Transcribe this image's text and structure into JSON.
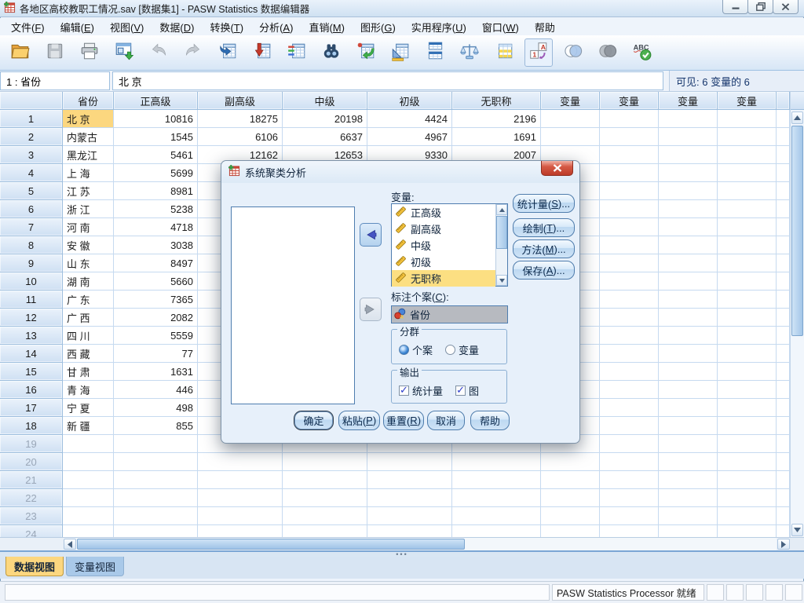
{
  "window": {
    "title": "各地区高校教职工情况.sav [数据集1] - PASW Statistics 数据编辑器"
  },
  "menu": {
    "items": [
      "文件(F)",
      "编辑(E)",
      "视图(V)",
      "数据(D)",
      "转换(T)",
      "分析(A)",
      "直销(M)",
      "图形(G)",
      "实用程序(U)",
      "窗口(W)",
      "帮助"
    ]
  },
  "toolbar": {
    "buttons": [
      {
        "name": "open-file",
        "enabled": true
      },
      {
        "name": "save",
        "enabled": false
      },
      {
        "name": "print",
        "enabled": true
      },
      {
        "name": "recall-dialogs",
        "enabled": true
      },
      {
        "name": "undo",
        "enabled": false
      },
      {
        "name": "redo",
        "enabled": false
      },
      {
        "name": "goto-case",
        "enabled": true
      },
      {
        "name": "goto-variable",
        "enabled": true
      },
      {
        "name": "variables",
        "enabled": true
      },
      {
        "name": "find",
        "enabled": true
      },
      {
        "name": "insert-cases",
        "enabled": true
      },
      {
        "name": "insert-variable",
        "enabled": true
      },
      {
        "name": "split-file",
        "enabled": true
      },
      {
        "name": "weight-cases",
        "enabled": true
      },
      {
        "name": "select-cases",
        "enabled": true
      },
      {
        "name": "value-labels",
        "enabled": true,
        "pressed": true
      },
      {
        "name": "use-variable-sets",
        "enabled": true
      },
      {
        "name": "show-all-variables",
        "enabled": true
      },
      {
        "name": "spell-check",
        "enabled": true
      }
    ]
  },
  "cellref": {
    "position": "1 : 省份",
    "value": "北 京",
    "visible_info": "可见: 6 变量的 6"
  },
  "grid": {
    "columns": [
      "省份",
      "正高级",
      "副高级",
      "中级",
      "初级",
      "无职称",
      "变量",
      "变量",
      "变量",
      "变量",
      ""
    ],
    "rows": [
      {
        "n": "1",
        "empty": false,
        "cells": [
          "北 京",
          "10816",
          "18275",
          "20198",
          "4424",
          "2196"
        ]
      },
      {
        "n": "2",
        "empty": false,
        "cells": [
          "内蒙古",
          "1545",
          "6106",
          "6637",
          "4967",
          "1691"
        ]
      },
      {
        "n": "3",
        "empty": false,
        "cells": [
          "黑龙江",
          "5461",
          "12162",
          "12653",
          "9330",
          "2007"
        ]
      },
      {
        "n": "4",
        "empty": false,
        "cells": [
          "上 海",
          "5699",
          "",
          "",
          "",
          ""
        ]
      },
      {
        "n": "5",
        "empty": false,
        "cells": [
          "江 苏",
          "8981",
          "",
          "",
          "",
          ""
        ]
      },
      {
        "n": "6",
        "empty": false,
        "cells": [
          "浙 江",
          "5238",
          "",
          "",
          "",
          ""
        ]
      },
      {
        "n": "7",
        "empty": false,
        "cells": [
          "河 南",
          "4718",
          "",
          "",
          "",
          ""
        ]
      },
      {
        "n": "8",
        "empty": false,
        "cells": [
          "安 徽",
          "3038",
          "",
          "",
          "",
          ""
        ]
      },
      {
        "n": "9",
        "empty": false,
        "cells": [
          "山 东",
          "8497",
          "",
          "",
          "",
          ""
        ]
      },
      {
        "n": "10",
        "empty": false,
        "cells": [
          "湖 南",
          "5660",
          "",
          "",
          "",
          ""
        ]
      },
      {
        "n": "11",
        "empty": false,
        "cells": [
          "广 东",
          "7365",
          "",
          "",
          "",
          ""
        ]
      },
      {
        "n": "12",
        "empty": false,
        "cells": [
          "广 西",
          "2082",
          "",
          "",
          "",
          ""
        ]
      },
      {
        "n": "13",
        "empty": false,
        "cells": [
          "四 川",
          "5559",
          "",
          "",
          "",
          ""
        ]
      },
      {
        "n": "14",
        "empty": false,
        "cells": [
          "西 藏",
          "77",
          "",
          "",
          "",
          ""
        ]
      },
      {
        "n": "15",
        "empty": false,
        "cells": [
          "甘 肃",
          "1631",
          "",
          "",
          "",
          ""
        ]
      },
      {
        "n": "16",
        "empty": false,
        "cells": [
          "青 海",
          "446",
          "",
          "",
          "",
          ""
        ]
      },
      {
        "n": "17",
        "empty": false,
        "cells": [
          "宁 夏",
          "498",
          "",
          "",
          "",
          ""
        ]
      },
      {
        "n": "18",
        "empty": false,
        "cells": [
          "新 疆",
          "855",
          "",
          "",
          "",
          ""
        ]
      },
      {
        "n": "19",
        "empty": true,
        "cells": [
          "",
          "",
          "",
          "",
          "",
          ""
        ]
      },
      {
        "n": "20",
        "empty": true,
        "cells": [
          "",
          "",
          "",
          "",
          "",
          ""
        ]
      },
      {
        "n": "21",
        "empty": true,
        "cells": [
          "",
          "",
          "",
          "",
          "",
          ""
        ]
      },
      {
        "n": "22",
        "empty": true,
        "cells": [
          "",
          "",
          "",
          "",
          "",
          ""
        ]
      },
      {
        "n": "23",
        "empty": true,
        "cells": [
          "",
          "",
          "",
          "",
          "",
          ""
        ]
      },
      {
        "n": "24",
        "empty": true,
        "cells": [
          "",
          "",
          "",
          "",
          "",
          ""
        ]
      }
    ]
  },
  "dialog": {
    "title": "系统聚类分析",
    "variables_label": "变量:",
    "variables": [
      {
        "label": "正高级",
        "measure": "scale",
        "selected": false
      },
      {
        "label": "副高级",
        "measure": "scale",
        "selected": false
      },
      {
        "label": "中级",
        "measure": "scale",
        "selected": false
      },
      {
        "label": "初级",
        "measure": "scale",
        "selected": false
      },
      {
        "label": "无职称",
        "measure": "scale",
        "selected": true
      }
    ],
    "side_buttons": [
      "统计量(S)...",
      "绘制(T)...",
      "方法(M)...",
      "保存(A)..."
    ],
    "label_cases": "标注个案(C):",
    "label_cases_value": {
      "label": "省份",
      "measure": "nominal"
    },
    "cluster_group": {
      "title": "分群",
      "options": [
        {
          "label": "个案",
          "selected": true
        },
        {
          "label": "变量",
          "selected": false
        }
      ]
    },
    "output_group": {
      "title": "输出",
      "options": [
        {
          "label": "统计量",
          "checked": true
        },
        {
          "label": "图",
          "checked": true
        }
      ]
    },
    "bottom_buttons": [
      {
        "label": "确定",
        "default": true
      },
      {
        "label": "粘贴(P)",
        "default": false
      },
      {
        "label": "重置(R)",
        "default": false
      },
      {
        "label": "取消",
        "default": false
      },
      {
        "label": "帮助",
        "default": false
      }
    ]
  },
  "view_tabs": [
    {
      "label": "数据视图",
      "active": true
    },
    {
      "label": "变量视图",
      "active": false
    }
  ],
  "status_bar": {
    "message": "PASW Statistics Processor 就绪"
  },
  "colors": {
    "active_cell": "#fcd77f",
    "list_selection": "#fcdf82",
    "active_tab": "#fcd77f",
    "dialog_close_red": "#bc3b28"
  }
}
